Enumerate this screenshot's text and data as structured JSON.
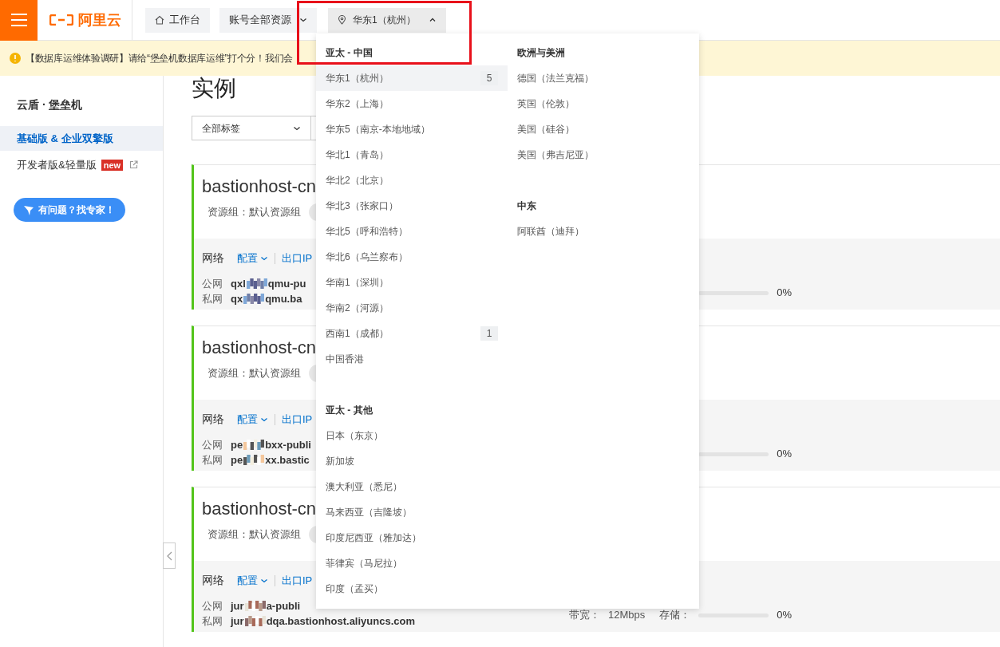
{
  "topbar": {
    "logo": "阿里云",
    "workbench": "工作台",
    "resources": "账号全部资源",
    "region": "华东1（杭州）",
    "region_open": true
  },
  "notice": "【数据库运维体验调研】请给“堡垒机数据库运维”打个分！我们会",
  "sidebar": {
    "title": "云盾 · 堡垒机",
    "items": [
      {
        "label": "基础版 & 企业双擎版",
        "selected": true
      },
      {
        "label": "开发者版&轻量版",
        "selected": false,
        "badge": "new",
        "external": true
      }
    ],
    "help_button": "有问题？找专家！"
  },
  "page_title": "实例",
  "filter": {
    "value": "全部标签"
  },
  "instances": [
    {
      "name": "bastionhost-cn",
      "resource_group": "资源组：默认资源组",
      "network_label": "网络",
      "config_link": "配置",
      "egress_link": "出口IP",
      "public_label": "公网",
      "public_prefix": "qxl",
      "public_suffix": "qmu-pu",
      "private_label": "私网",
      "private_prefix": "qx",
      "private_suffix": "qmu.ba",
      "storage": {
        "level": 0,
        "reading": "0%"
      }
    },
    {
      "name": "bastionhost-cn",
      "resource_group": "资源组：默认资源组",
      "network_label": "网络",
      "config_link": "配置",
      "egress_link": "出口IP",
      "public_label": "公网",
      "public_prefix": "pe",
      "public_suffix": "bxx-publi",
      "private_label": "私网",
      "private_prefix": "pe",
      "private_suffix": "xx.bastic",
      "storage": {
        "level": 0,
        "reading": "0%"
      }
    },
    {
      "name": "bastionhost-cn",
      "resource_group": "资源组：默认资源组",
      "network_label": "网络",
      "config_link": "配置",
      "egress_link": "出口IP",
      "public_label": "公网",
      "public_prefix": "jur",
      "public_suffix": "a-publi",
      "private_label": "私网",
      "private_prefix": "jur",
      "private_suffix": "dqa.bastionhost.aliyuncs.com",
      "bandwidth_label": "带宽：",
      "bandwidth": "12Mbps",
      "storage_label": "存储：",
      "storage": {
        "level": 0,
        "reading": "0%"
      }
    }
  ],
  "region_menu": {
    "columns": [
      {
        "groups": [
          {
            "title": "亚太 - 中国",
            "items": [
              {
                "label": "华东1（杭州）",
                "count": "5",
                "selected": true
              },
              {
                "label": "华东2（上海）",
                "selected": false
              },
              {
                "label": "华东5（南京-本地地域）",
                "selected": false
              },
              {
                "label": "华北1（青岛）",
                "selected": false
              },
              {
                "label": "华北2（北京）",
                "selected": false
              },
              {
                "label": "华北3（张家口）",
                "selected": false
              },
              {
                "label": "华北5（呼和浩特）",
                "selected": false
              },
              {
                "label": "华北6（乌兰察布）",
                "selected": false
              },
              {
                "label": "华南1（深圳）",
                "selected": false
              },
              {
                "label": "华南2（河源）",
                "selected": false
              },
              {
                "label": "西南1（成都）",
                "count": "1",
                "selected": false
              },
              {
                "label": "中国香港",
                "selected": false
              }
            ]
          },
          {
            "title": "亚太 - 其他",
            "items": [
              {
                "label": "日本（东京）",
                "selected": false
              },
              {
                "label": "新加坡",
                "selected": false
              },
              {
                "label": "澳大利亚（悉尼）",
                "selected": false
              },
              {
                "label": "马来西亚（吉隆坡）",
                "selected": false
              },
              {
                "label": "印度尼西亚（雅加达）",
                "selected": false
              },
              {
                "label": "菲律宾（马尼拉）",
                "selected": false
              },
              {
                "label": "印度（孟买）",
                "selected": false
              }
            ]
          }
        ]
      },
      {
        "groups": [
          {
            "title": "欧洲与美洲",
            "items": [
              {
                "label": "德国（法兰克福）",
                "selected": false
              },
              {
                "label": "英国（伦敦）",
                "selected": false
              },
              {
                "label": "美国（硅谷）",
                "selected": false
              },
              {
                "label": "美国（弗吉尼亚）",
                "selected": false
              }
            ]
          },
          {
            "title": "中东",
            "items": [
              {
                "label": "阿联酋（迪拜）",
                "selected": false
              }
            ]
          }
        ]
      }
    ]
  }
}
